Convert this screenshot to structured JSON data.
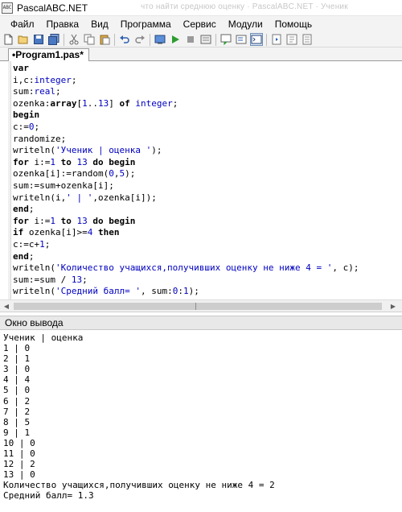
{
  "window": {
    "title": "PascalABC.NET",
    "icon_text": "ABC",
    "background_title": "что найти среднюю оценку · PascalABC.NET · Ученик"
  },
  "menu": {
    "items": [
      "Файл",
      "Правка",
      "Вид",
      "Программа",
      "Сервис",
      "Модули",
      "Помощь"
    ]
  },
  "toolbar": {
    "icons": [
      "new-file-icon",
      "open-folder-icon",
      "save-icon",
      "save-all-icon",
      "cut-icon",
      "copy-icon",
      "paste-icon",
      "undo-icon",
      "redo-icon",
      "compile-icon",
      "run-icon",
      "stop-icon",
      "debug-icon",
      "step-into-icon",
      "step-over-icon",
      "output-window-icon",
      "format-code-icon",
      "find-icon",
      "settings-icon"
    ],
    "active_icon": "output-window-icon"
  },
  "editor": {
    "tab_label": "•Program1.pas*",
    "code_lines": [
      [
        {
          "t": "var",
          "c": "kw"
        }
      ],
      [
        {
          "t": "i,c:",
          "c": ""
        },
        {
          "t": "integer",
          "c": "typ"
        },
        {
          "t": ";",
          "c": ""
        }
      ],
      [
        {
          "t": "sum:",
          "c": ""
        },
        {
          "t": "real",
          "c": "typ"
        },
        {
          "t": ";",
          "c": ""
        }
      ],
      [
        {
          "t": "ozenka:",
          "c": ""
        },
        {
          "t": "array",
          "c": "kw"
        },
        {
          "t": "[",
          "c": ""
        },
        {
          "t": "1",
          "c": "num"
        },
        {
          "t": "..",
          "c": ""
        },
        {
          "t": "13",
          "c": "num"
        },
        {
          "t": "] ",
          "c": ""
        },
        {
          "t": "of",
          "c": "kw"
        },
        {
          "t": " ",
          "c": ""
        },
        {
          "t": "integer",
          "c": "typ"
        },
        {
          "t": ";",
          "c": ""
        }
      ],
      [
        {
          "t": "begin",
          "c": "kw"
        }
      ],
      [
        {
          "t": "c:=",
          "c": ""
        },
        {
          "t": "0",
          "c": "num"
        },
        {
          "t": ";",
          "c": ""
        }
      ],
      [
        {
          "t": "randomize;",
          "c": ""
        }
      ],
      [
        {
          "t": "writeln(",
          "c": ""
        },
        {
          "t": "'Ученик | оценка '",
          "c": "str"
        },
        {
          "t": ");",
          "c": ""
        }
      ],
      [
        {
          "t": "for",
          "c": "kw"
        },
        {
          "t": " i:=",
          "c": ""
        },
        {
          "t": "1",
          "c": "num"
        },
        {
          "t": " ",
          "c": ""
        },
        {
          "t": "to",
          "c": "kw"
        },
        {
          "t": " ",
          "c": ""
        },
        {
          "t": "13",
          "c": "num"
        },
        {
          "t": " ",
          "c": ""
        },
        {
          "t": "do",
          "c": "kw"
        },
        {
          "t": " ",
          "c": ""
        },
        {
          "t": "begin",
          "c": "kw"
        }
      ],
      [
        {
          "t": "ozenka[i]:=random(",
          "c": ""
        },
        {
          "t": "0",
          "c": "num"
        },
        {
          "t": ",",
          "c": ""
        },
        {
          "t": "5",
          "c": "num"
        },
        {
          "t": ");",
          "c": ""
        }
      ],
      [
        {
          "t": "sum:=sum+ozenka[i];",
          "c": ""
        }
      ],
      [
        {
          "t": "writeln(i,",
          "c": ""
        },
        {
          "t": "' | '",
          "c": "str"
        },
        {
          "t": ",ozenka[i]);",
          "c": ""
        }
      ],
      [
        {
          "t": "end",
          "c": "kw"
        },
        {
          "t": ";",
          "c": ""
        }
      ],
      [
        {
          "t": "for",
          "c": "kw"
        },
        {
          "t": " i:=",
          "c": ""
        },
        {
          "t": "1",
          "c": "num"
        },
        {
          "t": " ",
          "c": ""
        },
        {
          "t": "to",
          "c": "kw"
        },
        {
          "t": " ",
          "c": ""
        },
        {
          "t": "13",
          "c": "num"
        },
        {
          "t": " ",
          "c": ""
        },
        {
          "t": "do",
          "c": "kw"
        },
        {
          "t": " ",
          "c": ""
        },
        {
          "t": "begin",
          "c": "kw"
        }
      ],
      [
        {
          "t": "if",
          "c": "kw"
        },
        {
          "t": " ozenka[i]>=",
          "c": ""
        },
        {
          "t": "4",
          "c": "num"
        },
        {
          "t": " ",
          "c": ""
        },
        {
          "t": "then",
          "c": "kw"
        }
      ],
      [
        {
          "t": "c:=c+",
          "c": ""
        },
        {
          "t": "1",
          "c": "num"
        },
        {
          "t": ";",
          "c": ""
        }
      ],
      [
        {
          "t": "end",
          "c": "kw"
        },
        {
          "t": ";",
          "c": ""
        }
      ],
      [
        {
          "t": "writeln(",
          "c": ""
        },
        {
          "t": "'Количество учащихся,получивших оценку не ниже 4 = '",
          "c": "str"
        },
        {
          "t": ", c);",
          "c": ""
        }
      ],
      [
        {
          "t": "sum:=sum / ",
          "c": ""
        },
        {
          "t": "13",
          "c": "num"
        },
        {
          "t": ";",
          "c": ""
        }
      ],
      [
        {
          "t": "writeln(",
          "c": ""
        },
        {
          "t": "'Средний балл= '",
          "c": "str"
        },
        {
          "t": ", sum:",
          "c": ""
        },
        {
          "t": "0",
          "c": "num"
        },
        {
          "t": ":",
          "c": ""
        },
        {
          "t": "1",
          "c": "num"
        },
        {
          "t": ");",
          "c": ""
        }
      ],
      [
        {
          "t": "end",
          "c": "kw"
        },
        {
          "t": ".",
          "c": ""
        }
      ]
    ]
  },
  "output": {
    "header": "Окно вывода",
    "lines": [
      "Ученик | оценка",
      "1 | 0",
      "2 | 1",
      "3 | 0",
      "4 | 4",
      "5 | 0",
      "6 | 2",
      "7 | 2",
      "8 | 5",
      "9 | 1",
      "10 | 0",
      "11 | 0",
      "12 | 2",
      "13 | 0",
      "Количество учащихся,получивших оценку не ниже 4 = 2",
      "Средний балл= 1.3"
    ]
  },
  "colors": {
    "keyword": "#000000",
    "literal": "#0000c0",
    "chrome": "#f3f3f3",
    "output_header": "#e8e8e8"
  }
}
